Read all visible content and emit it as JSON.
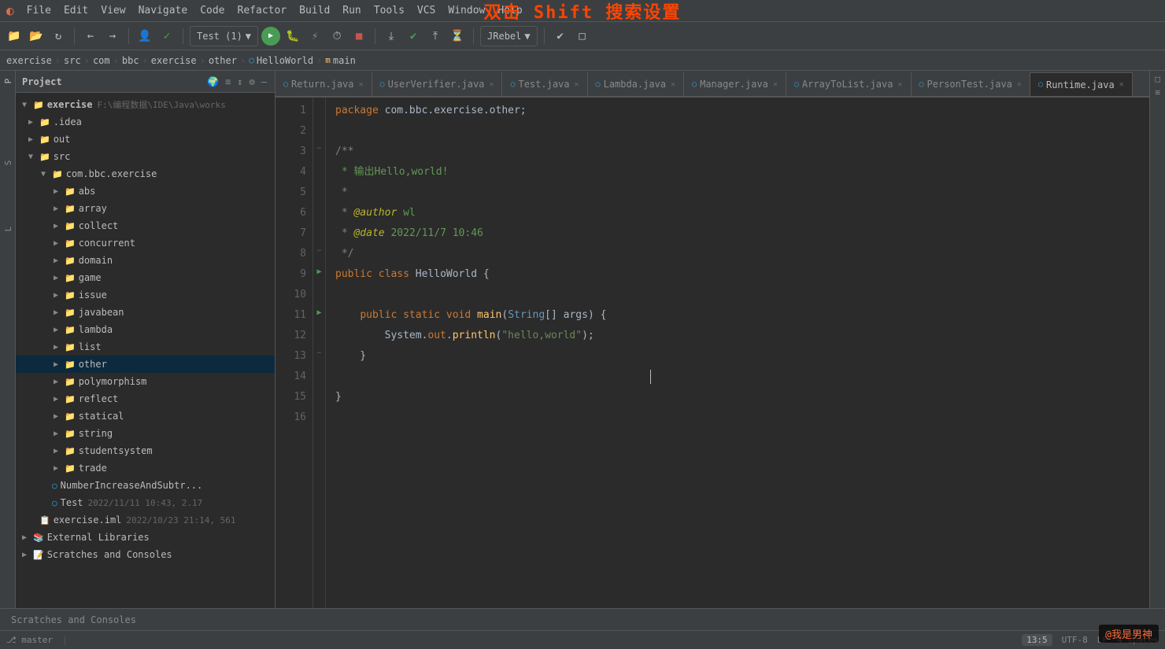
{
  "app": {
    "title": "IntelliJ IDEA",
    "overlay_text": "双击 Shift 搜索设置"
  },
  "menu": {
    "items": [
      "File",
      "Edit",
      "View",
      "Navigate",
      "Code",
      "Refactor",
      "Build",
      "Run",
      "Tools",
      "VCS",
      "Window",
      "Help"
    ]
  },
  "toolbar": {
    "run_config": "Test (1)",
    "jrebel_label": "JRebel"
  },
  "breadcrumb": {
    "items": [
      "exercise",
      "src",
      "com",
      "bbc",
      "exercise",
      "other",
      "HelloWorld",
      "main"
    ]
  },
  "tabs": [
    {
      "label": "Return.java",
      "active": false
    },
    {
      "label": "UserVerifier.java",
      "active": false
    },
    {
      "label": "Test.java",
      "active": false
    },
    {
      "label": "Lambda.java",
      "active": false
    },
    {
      "label": "Manager.java",
      "active": false
    },
    {
      "label": "ArrayToList.java",
      "active": false
    },
    {
      "label": "PersonTest.java",
      "active": false
    },
    {
      "label": "Runtime.java",
      "active": true
    }
  ],
  "project_panel": {
    "title": "Project",
    "root": {
      "name": "exercise",
      "path": "F:\\编程数据\\IDE\\Java\\works"
    },
    "tree": [
      {
        "label": ".idea",
        "indent": 3,
        "type": "folder",
        "collapsed": true
      },
      {
        "label": "out",
        "indent": 3,
        "type": "folder",
        "collapsed": true
      },
      {
        "label": "src",
        "indent": 3,
        "type": "folder",
        "collapsed": false
      },
      {
        "label": "com.bbc.exercise",
        "indent": 4,
        "type": "folder",
        "collapsed": false
      },
      {
        "label": "abs",
        "indent": 5,
        "type": "folder",
        "collapsed": true
      },
      {
        "label": "array",
        "indent": 5,
        "type": "folder",
        "collapsed": true
      },
      {
        "label": "collect",
        "indent": 5,
        "type": "folder",
        "collapsed": true
      },
      {
        "label": "concurrent",
        "indent": 5,
        "type": "folder",
        "collapsed": true
      },
      {
        "label": "domain",
        "indent": 5,
        "type": "folder",
        "collapsed": true
      },
      {
        "label": "game",
        "indent": 5,
        "type": "folder",
        "collapsed": true
      },
      {
        "label": "issue",
        "indent": 5,
        "type": "folder",
        "collapsed": true
      },
      {
        "label": "javabean",
        "indent": 5,
        "type": "folder",
        "collapsed": true
      },
      {
        "label": "lambda",
        "indent": 5,
        "type": "folder",
        "collapsed": true
      },
      {
        "label": "list",
        "indent": 5,
        "type": "folder",
        "collapsed": true
      },
      {
        "label": "other",
        "indent": 5,
        "type": "folder",
        "collapsed": true,
        "selected": true
      },
      {
        "label": "polymorphism",
        "indent": 5,
        "type": "folder",
        "collapsed": true
      },
      {
        "label": "reflect",
        "indent": 5,
        "type": "folder",
        "collapsed": true
      },
      {
        "label": "statical",
        "indent": 5,
        "type": "folder",
        "collapsed": true
      },
      {
        "label": "string",
        "indent": 5,
        "type": "folder",
        "collapsed": true
      },
      {
        "label": "studentsystem",
        "indent": 5,
        "type": "folder",
        "collapsed": true
      },
      {
        "label": "trade",
        "indent": 5,
        "type": "folder",
        "collapsed": true
      },
      {
        "label": "NumberIncreaseAndSubtr...",
        "indent": 4,
        "type": "java",
        "collapsed": true
      },
      {
        "label": "Test",
        "indent": 4,
        "type": "java",
        "meta": "2022/11/11 10:43, 2.17",
        "collapsed": true
      },
      {
        "label": "exercise.iml",
        "indent": 3,
        "type": "iml",
        "meta": "2022/10/23 21:14, 561"
      },
      {
        "label": "External Libraries",
        "indent": 2,
        "type": "folder",
        "collapsed": true
      },
      {
        "label": "Scratches and Consoles",
        "indent": 2,
        "type": "folder",
        "collapsed": true
      }
    ]
  },
  "code": {
    "filename": "Runtime.java",
    "lines": [
      {
        "num": 1,
        "tokens": [
          {
            "t": "kw",
            "v": "package"
          },
          {
            "t": "plain",
            "v": " com.bbc.exercise.other;"
          }
        ]
      },
      {
        "num": 2,
        "tokens": []
      },
      {
        "num": 3,
        "tokens": [
          {
            "t": "comment",
            "v": "/**"
          }
        ],
        "fold": true,
        "fold_type": "open"
      },
      {
        "num": 4,
        "tokens": [
          {
            "t": "comment-green",
            "v": " * 输出Hello,world!"
          }
        ]
      },
      {
        "num": 5,
        "tokens": [
          {
            "t": "comment",
            "v": " *"
          }
        ]
      },
      {
        "num": 6,
        "tokens": [
          {
            "t": "comment",
            "v": " * "
          },
          {
            "t": "annotation-italic",
            "v": "@author"
          },
          {
            "t": "comment-green",
            "v": " wl"
          }
        ]
      },
      {
        "num": 7,
        "tokens": [
          {
            "t": "comment",
            "v": " * "
          },
          {
            "t": "annotation-italic",
            "v": "@date"
          },
          {
            "t": "comment-green",
            "v": " 2022/11/7 10:46"
          }
        ]
      },
      {
        "num": 8,
        "tokens": [
          {
            "t": "comment",
            "v": " */"
          }
        ],
        "fold_end": true
      },
      {
        "num": 9,
        "tokens": [
          {
            "t": "kw",
            "v": "public"
          },
          {
            "t": "plain",
            "v": " "
          },
          {
            "t": "kw",
            "v": "class"
          },
          {
            "t": "plain",
            "v": " "
          },
          {
            "t": "class-name",
            "v": "HelloWorld"
          },
          {
            "t": "plain",
            "v": " {"
          }
        ],
        "runnable": true
      },
      {
        "num": 10,
        "tokens": []
      },
      {
        "num": 11,
        "tokens": [
          {
            "t": "plain",
            "v": "    "
          },
          {
            "t": "kw",
            "v": "public"
          },
          {
            "t": "plain",
            "v": " "
          },
          {
            "t": "kw",
            "v": "static"
          },
          {
            "t": "plain",
            "v": " "
          },
          {
            "t": "kw",
            "v": "void"
          },
          {
            "t": "plain",
            "v": " "
          },
          {
            "t": "method",
            "v": "main"
          },
          {
            "t": "plain",
            "v": "("
          },
          {
            "t": "kw-blue",
            "v": "String"
          },
          {
            "t": "plain",
            "v": "[] args) {"
          }
        ],
        "runnable": true,
        "fold": true,
        "fold_type": "open"
      },
      {
        "num": 12,
        "tokens": [
          {
            "t": "plain",
            "v": "        System."
          },
          {
            "t": "kw",
            "v": "out"
          },
          {
            "t": "plain",
            "v": "."
          },
          {
            "t": "method",
            "v": "println"
          },
          {
            "t": "plain",
            "v": "("
          },
          {
            "t": "str",
            "v": "\"hello,world\""
          },
          {
            "t": "plain",
            "v": ");"
          }
        ]
      },
      {
        "num": 13,
        "tokens": [
          {
            "t": "plain",
            "v": "    }"
          }
        ],
        "fold_end": true
      },
      {
        "num": 14,
        "tokens": []
      },
      {
        "num": 15,
        "tokens": [
          {
            "t": "plain",
            "v": "}"
          }
        ]
      },
      {
        "num": 16,
        "tokens": []
      }
    ]
  },
  "bottom_tabs": [
    "Scratches and Consoles"
  ],
  "status": {
    "cursor": "13:5",
    "encoding": "UTF-8",
    "line_sep": "LF",
    "indent": "4 spaces"
  },
  "watermark": "@我是男神"
}
